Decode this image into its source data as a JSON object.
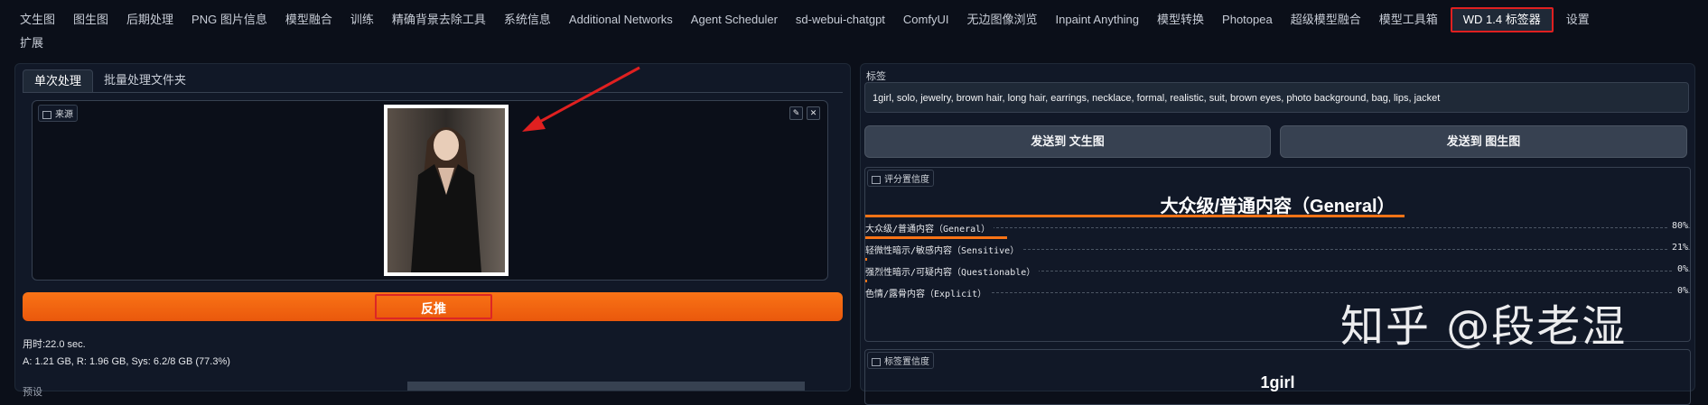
{
  "tabs_row1": [
    "文生图",
    "图生图",
    "后期处理",
    "PNG 图片信息",
    "模型融合",
    "训练",
    "精确背景去除工具",
    "系统信息",
    "Additional Networks",
    "Agent Scheduler",
    "sd-webui-chatgpt",
    "ComfyUI",
    "无边图像浏览",
    "Inpaint Anything",
    "模型转换",
    "Photopea",
    "超级模型融合",
    "模型工具箱",
    "WD 1.4 标签器",
    "设置"
  ],
  "tabs_row2": [
    "扩展"
  ],
  "active_tab": "WD 1.4 标签器",
  "left": {
    "subtabs": [
      "单次处理",
      "批量处理文件夹"
    ],
    "image_label": "来源",
    "tools": [
      "✎",
      "✕"
    ],
    "run_button": "反推",
    "time_text": "用时:22.0 sec.",
    "memory_text": "A: 1.21 GB, R: 1.96 GB, Sys: 6.2/8 GB (77.3%)",
    "preset_label": "预设"
  },
  "right": {
    "tags_label": "标签",
    "tags_value": "1girl, solo, jewelry, brown hair, long hair, earrings, necklace, formal, realistic, suit, brown eyes, photo background, bag, lips, jacket",
    "send_txt2img": "发送到 文生图",
    "send_img2img": "发送到 图生图",
    "rating_label": "评分置信度",
    "top_rating": "大众级/普通内容（General）",
    "ratings": [
      {
        "name": "大众级/普通内容（General）",
        "value": "80%",
        "fraction": 0.8
      },
      {
        "name": "轻微性暗示/敏感内容（Sensitive）",
        "value": "21%",
        "fraction": 0.21
      },
      {
        "name": "强烈性暗示/可疑内容（Questionable）",
        "value": "0%",
        "fraction": 0.003
      },
      {
        "name": "色情/露骨内容（Explicit）",
        "value": "0%",
        "fraction": 0.002
      }
    ],
    "tag_conf_label": "标签置信度",
    "top_tag": "1girl"
  },
  "watermark": "知乎 @段老湿",
  "colors": {
    "accent": "#f97316",
    "highlight_box": "#dc2626",
    "background": "#0b0f19"
  }
}
